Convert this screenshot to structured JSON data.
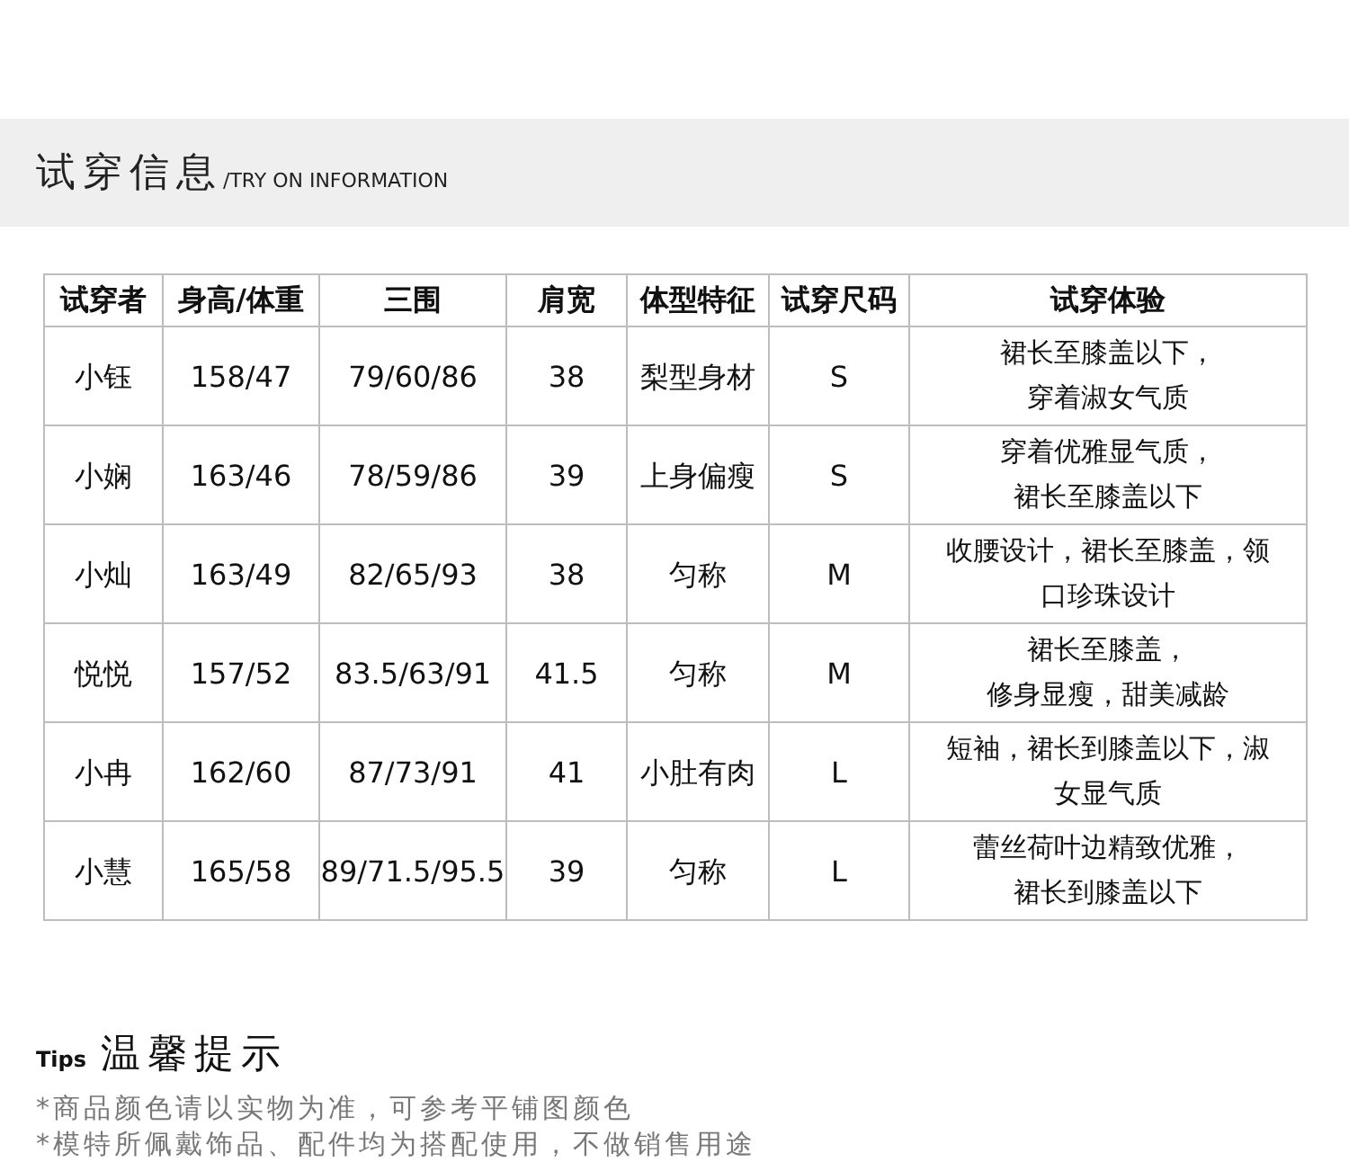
{
  "section": {
    "title": "试穿信息",
    "subtitle": "/TRY ON INFORMATION"
  },
  "table": {
    "columns": [
      "试穿者",
      "身高/体重",
      "三围",
      "肩宽",
      "体型特征",
      "试穿尺码",
      "试穿体验"
    ],
    "rows": [
      {
        "cells": [
          "小钰",
          "158/47",
          "79/60/86",
          "38",
          "梨型身材",
          "S"
        ],
        "experience": [
          "裙长至膝盖以下，",
          "穿着淑女气质"
        ]
      },
      {
        "cells": [
          "小娴",
          "163/46",
          "78/59/86",
          "39",
          "上身偏瘦",
          "S"
        ],
        "experience": [
          "穿着优雅显气质，",
          "裙长至膝盖以下"
        ]
      },
      {
        "cells": [
          "小灿",
          "163/49",
          "82/65/93",
          "38",
          "匀称",
          "M"
        ],
        "experience": [
          "收腰设计，裙长至膝盖，领",
          "口珍珠设计"
        ]
      },
      {
        "cells": [
          "悦悦",
          "157/52",
          "83.5/63/91",
          "41.5",
          "匀称",
          "M"
        ],
        "experience": [
          "裙长至膝盖，",
          "修身显瘦，甜美减龄"
        ]
      },
      {
        "cells": [
          "小冉",
          "162/60",
          "87/73/91",
          "41",
          "小肚有肉",
          "L"
        ],
        "experience": [
          "短袖，裙长到膝盖以下，淑",
          "女显气质"
        ]
      },
      {
        "cells": [
          "小慧",
          "165/58",
          "89/71.5/95.5",
          "39",
          "匀称",
          "L"
        ],
        "experience": [
          "蕾丝荷叶边精致优雅，",
          "裙长到膝盖以下"
        ]
      }
    ]
  },
  "tips": {
    "label": "Tips",
    "title": "温馨提示",
    "notes": [
      "*商品颜色请以实物为准，可参考平铺图颜色",
      "*模特所佩戴饰品、配件均为搭配使用，不做销售用途"
    ]
  }
}
